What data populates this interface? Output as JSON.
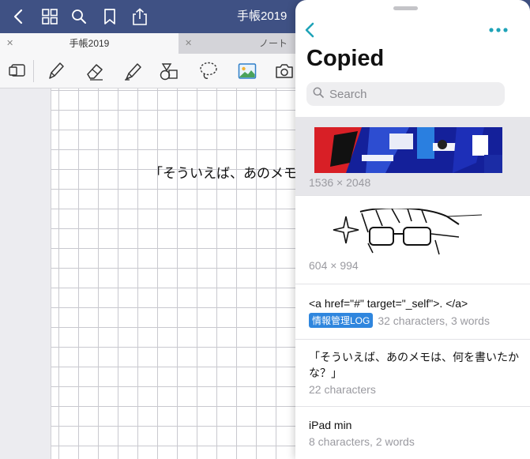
{
  "app": {
    "title": "手帳2019",
    "tabs": [
      {
        "label": "手帳2019",
        "active": true
      },
      {
        "label": "ノート",
        "active": false
      }
    ],
    "nav_icons": [
      "back-icon",
      "grid-icon",
      "search-icon",
      "bookmark-icon",
      "share-icon"
    ],
    "tools": [
      "page-layout-icon",
      "pen-icon",
      "eraser-icon",
      "highlighter-icon",
      "shapes-icon",
      "lasso-icon",
      "image-icon",
      "camera-icon"
    ],
    "page_text": "「そういえば、あのメモ"
  },
  "panel": {
    "title": "Copied",
    "search_placeholder": "Search",
    "accent_color": "#1fa3b8",
    "items": [
      {
        "kind": "image",
        "meta": "1536 × 2048"
      },
      {
        "kind": "image",
        "meta": "604 × 994"
      },
      {
        "kind": "text",
        "text": "<a href=\"#\" target=\"_self\">.  </a>",
        "badge": "情報管理LOG",
        "meta": "32 characters, 3 words"
      },
      {
        "kind": "text",
        "text": "「そういえば、あのメモは、何を書いたかな？」",
        "meta": "22 characters"
      },
      {
        "kind": "text",
        "text": "iPad min",
        "meta": "8 characters, 2 words"
      }
    ]
  }
}
